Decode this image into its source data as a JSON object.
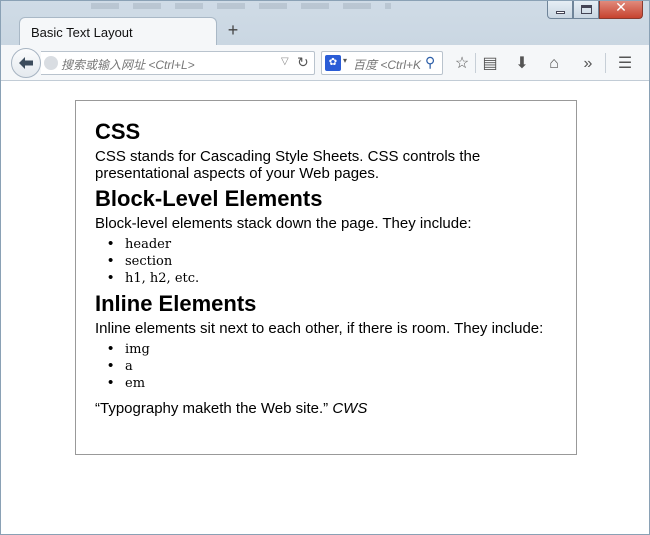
{
  "window": {
    "tab_title": "Basic Text Layout",
    "new_tab_label": "+",
    "url_placeholder": "搜索或输入网址 <Ctrl+L>",
    "search_placeholder": "百度 <Ctrl+K",
    "search_engine_name": "百度",
    "close_label": "✕"
  },
  "page": {
    "sections": [
      {
        "heading": "CSS",
        "text": "CSS stands for Cascading Style Sheets. CSS controls the presentational aspects of your Web pages."
      },
      {
        "heading": "Block-Level Elements",
        "text": "Block-level elements stack down the page. They include:",
        "items": [
          "header",
          "section",
          "h1, h2, etc."
        ]
      },
      {
        "heading": "Inline Elements",
        "text": "Inline elements sit next to each other, if there is room. They include:",
        "items": [
          "img",
          "a",
          "em"
        ]
      }
    ],
    "quote": "“Typography maketh the Web site.”",
    "quote_author": "CWS"
  },
  "colors": {
    "titlebar": "#c9d6e2",
    "close_button": "#c7432f",
    "box_border": "#999999"
  }
}
